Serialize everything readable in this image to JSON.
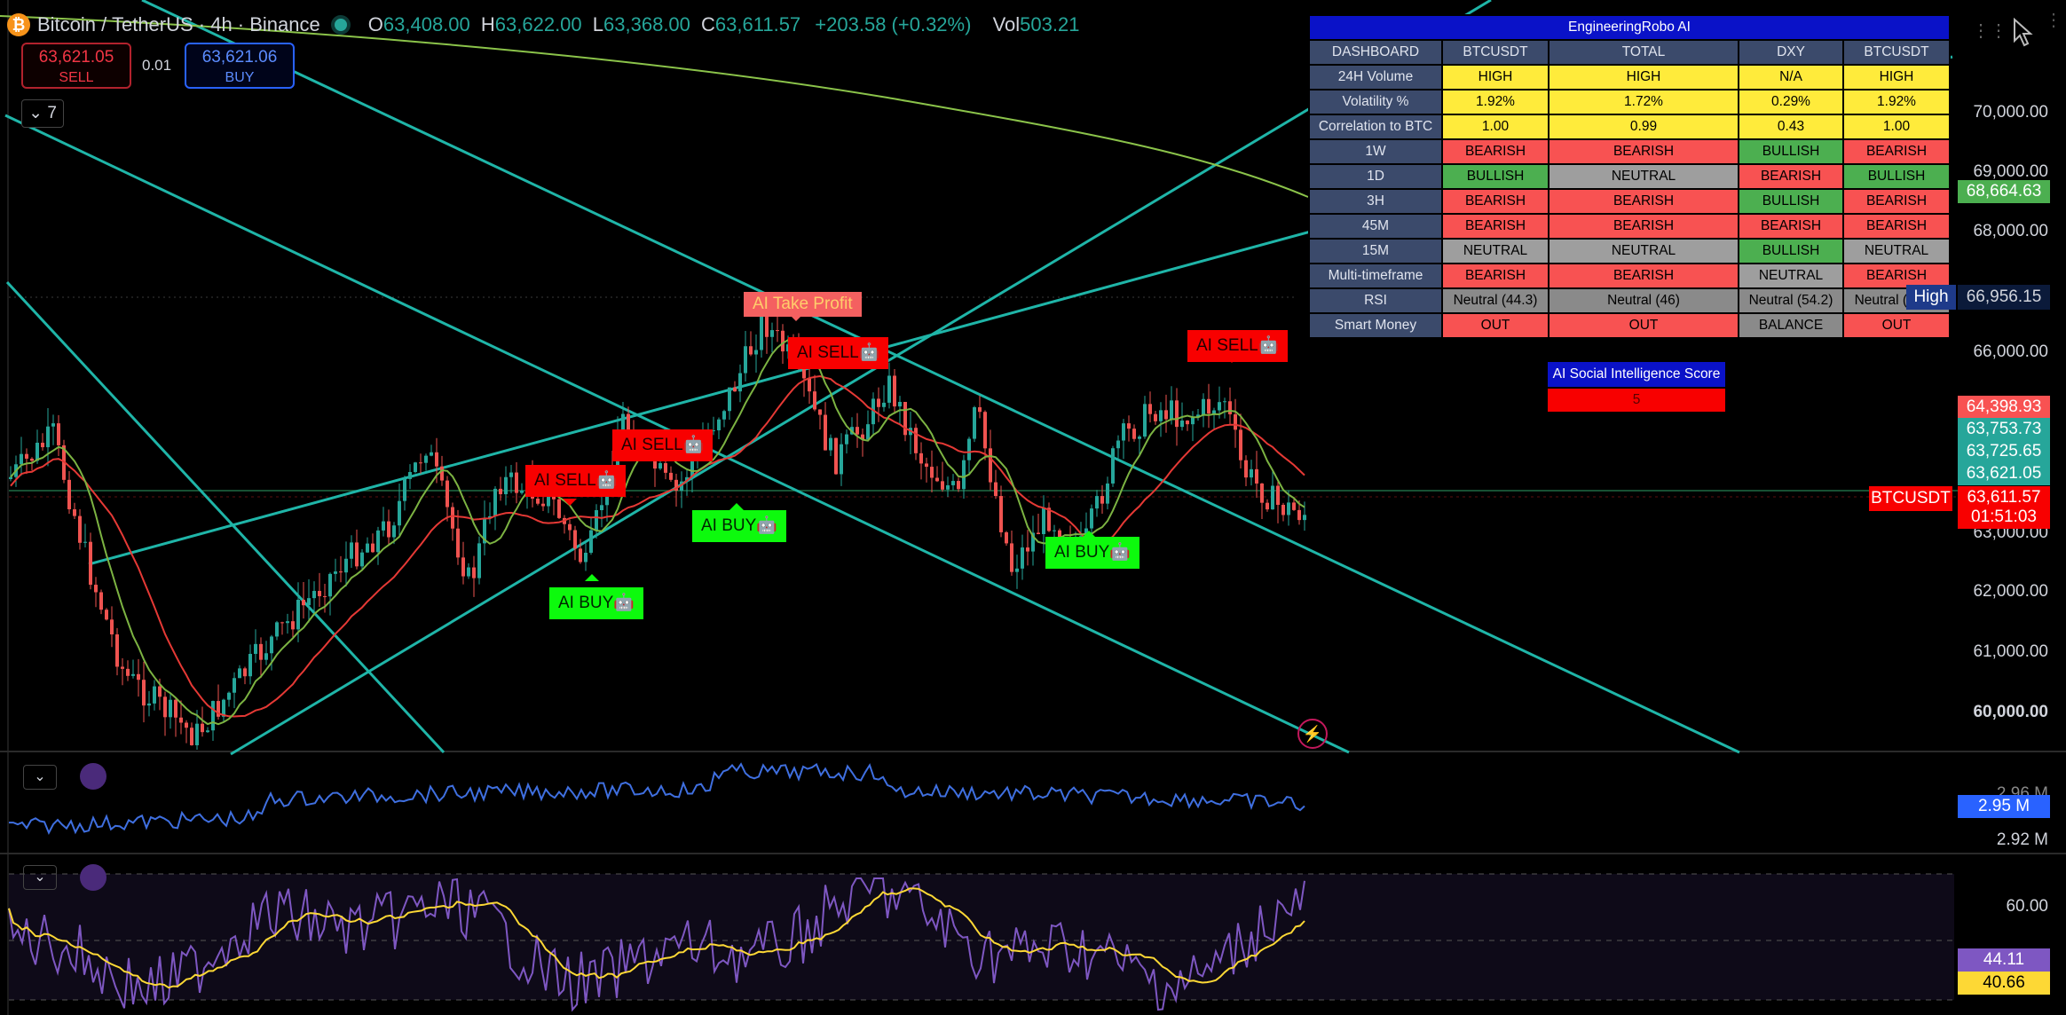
{
  "header": {
    "coin_symbol": "₿",
    "title": "Bitcoin / TetherUS · 4h · Binance",
    "ohlc": [
      {
        "k": "O",
        "v": "63,408.00"
      },
      {
        "k": "H",
        "v": "63,622.00"
      },
      {
        "k": "L",
        "v": "63,368.00"
      },
      {
        "k": "C",
        "v": "63,611.57"
      }
    ],
    "change": "+203.58 (+0.32%)",
    "vol_label": "Vol",
    "vol_value": "503.21"
  },
  "trade": {
    "sell_price": "63,621.05",
    "sell_label": "SELL",
    "spread": "0.01",
    "buy_price": "63,621.06",
    "buy_label": "BUY"
  },
  "indicator_toggle": "7",
  "dashboard": {
    "title": "EngineeringRobo AI",
    "columns": [
      "DASHBOARD",
      "BTCUSDT",
      "TOTAL",
      "DXY",
      "BTCUSDT"
    ],
    "rows": [
      {
        "label": "24H Volume",
        "cells": [
          {
            "t": "HIGH",
            "c": "yel"
          },
          {
            "t": "HIGH",
            "c": "yel"
          },
          {
            "t": "N/A",
            "c": "yel"
          },
          {
            "t": "HIGH",
            "c": "yel"
          }
        ]
      },
      {
        "label": "Volatility %",
        "cells": [
          {
            "t": "1.92%",
            "c": "yel"
          },
          {
            "t": "1.72%",
            "c": "yel"
          },
          {
            "t": "0.29%",
            "c": "yel"
          },
          {
            "t": "1.92%",
            "c": "yel"
          }
        ]
      },
      {
        "label": "Correlation to BTC",
        "cells": [
          {
            "t": "1.00",
            "c": "yel"
          },
          {
            "t": "0.99",
            "c": "yel"
          },
          {
            "t": "0.43",
            "c": "yel"
          },
          {
            "t": "1.00",
            "c": "yel"
          }
        ]
      },
      {
        "label": "1W",
        "cells": [
          {
            "t": "BEARISH",
            "c": "red"
          },
          {
            "t": "BEARISH",
            "c": "red"
          },
          {
            "t": "BULLISH",
            "c": "grn"
          },
          {
            "t": "BEARISH",
            "c": "red"
          }
        ]
      },
      {
        "label": "1D",
        "cells": [
          {
            "t": "BULLISH",
            "c": "grn"
          },
          {
            "t": "NEUTRAL",
            "c": "gry"
          },
          {
            "t": "BEARISH",
            "c": "red"
          },
          {
            "t": "BULLISH",
            "c": "grn"
          }
        ]
      },
      {
        "label": "3H",
        "cells": [
          {
            "t": "BEARISH",
            "c": "red"
          },
          {
            "t": "BEARISH",
            "c": "red"
          },
          {
            "t": "BULLISH",
            "c": "grn"
          },
          {
            "t": "BEARISH",
            "c": "red"
          }
        ]
      },
      {
        "label": "45M",
        "cells": [
          {
            "t": "BEARISH",
            "c": "red"
          },
          {
            "t": "BEARISH",
            "c": "red"
          },
          {
            "t": "BEARISH",
            "c": "red"
          },
          {
            "t": "BEARISH",
            "c": "red"
          }
        ]
      },
      {
        "label": "15M",
        "cells": [
          {
            "t": "NEUTRAL",
            "c": "gry"
          },
          {
            "t": "NEUTRAL",
            "c": "gry"
          },
          {
            "t": "BULLISH",
            "c": "grn"
          },
          {
            "t": "NEUTRAL",
            "c": "gry"
          }
        ]
      },
      {
        "label": "Multi-timeframe",
        "cells": [
          {
            "t": "BEARISH",
            "c": "red"
          },
          {
            "t": "BEARISH",
            "c": "red"
          },
          {
            "t": "NEUTRAL",
            "c": "gry"
          },
          {
            "t": "BEARISH",
            "c": "red"
          }
        ]
      },
      {
        "label": "RSI",
        "cells": [
          {
            "t": "Neutral (44.3)",
            "c": "gry2"
          },
          {
            "t": "Neutral (46)",
            "c": "gry2"
          },
          {
            "t": "Neutral (54.2)",
            "c": "gry2"
          },
          {
            "t": "Neutral (44.3)",
            "c": "gry2"
          }
        ]
      },
      {
        "label": "Smart Money",
        "cells": [
          {
            "t": "OUT",
            "c": "red"
          },
          {
            "t": "OUT",
            "c": "red"
          },
          {
            "t": "BALANCE",
            "c": "gry2"
          },
          {
            "t": "OUT",
            "c": "red"
          }
        ]
      }
    ],
    "social_title": "AI Social Intelligence Score",
    "social_value": "5"
  },
  "signals": {
    "take_profit": "AI Take Profit",
    "sell_1": "AI SELL🤖",
    "sell_2": "AI SELL🤖",
    "sell_3": "AI SELL🤖",
    "sell_4": "AI SELL🤖",
    "buy_1": "AI BUY🤖",
    "buy_2": "AI BUY🤖",
    "buy_3": "AI BUY🤖"
  },
  "price_axis": [
    "70,000.00",
    "69,000.00",
    "68,000.00",
    "66,000.00",
    "63,000.00",
    "62,000.00",
    "61,000.00",
    "60,000.00"
  ],
  "price_tags": {
    "t1": "68,664.63",
    "high_label": "High",
    "high_value": "66,956.15",
    "t2": "64,398.93",
    "t3": "63,753.73",
    "t4": "63,725.65",
    "t5": "63,621.05",
    "symbol_label": "BTCUSDT",
    "last": "63,611.57",
    "countdown": "01:51:03"
  },
  "volume_pane": {
    "axis_top": "2.96 M",
    "value": "2.95 M",
    "axis_bottom": "2.92 M"
  },
  "rsi_pane": {
    "axis_level": "60.00",
    "rsi_value": "44.11",
    "ma_value": "40.66"
  },
  "colors": {
    "up": "#26a69a",
    "down": "#ef5350",
    "channel": "#1fb5a8",
    "ma_red": "#e53935",
    "ma_green": "#7cb342",
    "ma_olive": "#8bc34a",
    "rsi": "#7e57c2",
    "rsi_ma": "#fdd835",
    "obv": "#3f6fe0"
  },
  "icons": [
    "bitcoin-icon",
    "market-status-dot-icon",
    "chevron-down-icon",
    "sync-icon",
    "lightning-icon",
    "cursor-icon",
    "drag-handle-icon"
  ]
}
